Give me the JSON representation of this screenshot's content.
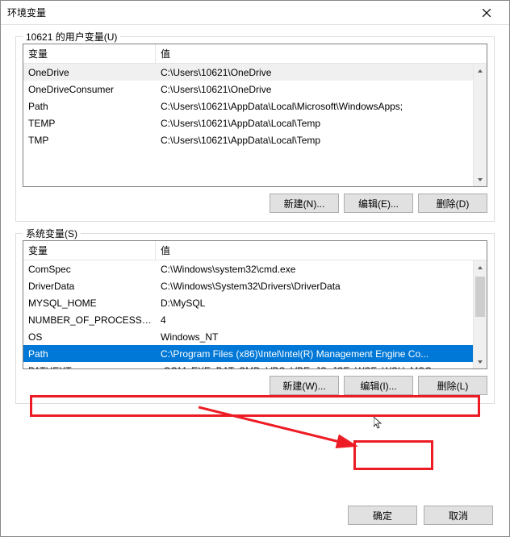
{
  "title": "环境变量",
  "user_group_label": "10621 的用户变量(U)",
  "system_group_label": "系统变量(S)",
  "columns": {
    "var": "变量",
    "val": "值"
  },
  "user_vars": [
    {
      "name": "OneDrive",
      "value": "C:\\Users\\10621\\OneDrive"
    },
    {
      "name": "OneDriveConsumer",
      "value": "C:\\Users\\10621\\OneDrive"
    },
    {
      "name": "Path",
      "value": "C:\\Users\\10621\\AppData\\Local\\Microsoft\\WindowsApps;"
    },
    {
      "name": "TEMP",
      "value": "C:\\Users\\10621\\AppData\\Local\\Temp"
    },
    {
      "name": "TMP",
      "value": "C:\\Users\\10621\\AppData\\Local\\Temp"
    }
  ],
  "system_vars": [
    {
      "name": "ComSpec",
      "value": "C:\\Windows\\system32\\cmd.exe"
    },
    {
      "name": "DriverData",
      "value": "C:\\Windows\\System32\\Drivers\\DriverData"
    },
    {
      "name": "MYSQL_HOME",
      "value": "D:\\MySQL"
    },
    {
      "name": "NUMBER_OF_PROCESSORS",
      "value": "4"
    },
    {
      "name": "OS",
      "value": "Windows_NT"
    },
    {
      "name": "Path",
      "value": "C:\\Program Files (x86)\\Intel\\Intel(R) Management Engine Co..."
    },
    {
      "name": "PATHEXT",
      "value": ".COM;.EXE;.BAT;.CMD;.VBS;.VBE;.JS;.JSE;.WSF;.WSH;.MSC"
    }
  ],
  "buttons": {
    "new_n": "新建(N)...",
    "edit_e": "编辑(E)...",
    "delete_d": "删除(D)",
    "new_w": "新建(W)...",
    "edit_i": "编辑(I)...",
    "delete_l": "删除(L)",
    "ok": "确定",
    "cancel": "取消"
  },
  "selected_system_row_index": 5
}
